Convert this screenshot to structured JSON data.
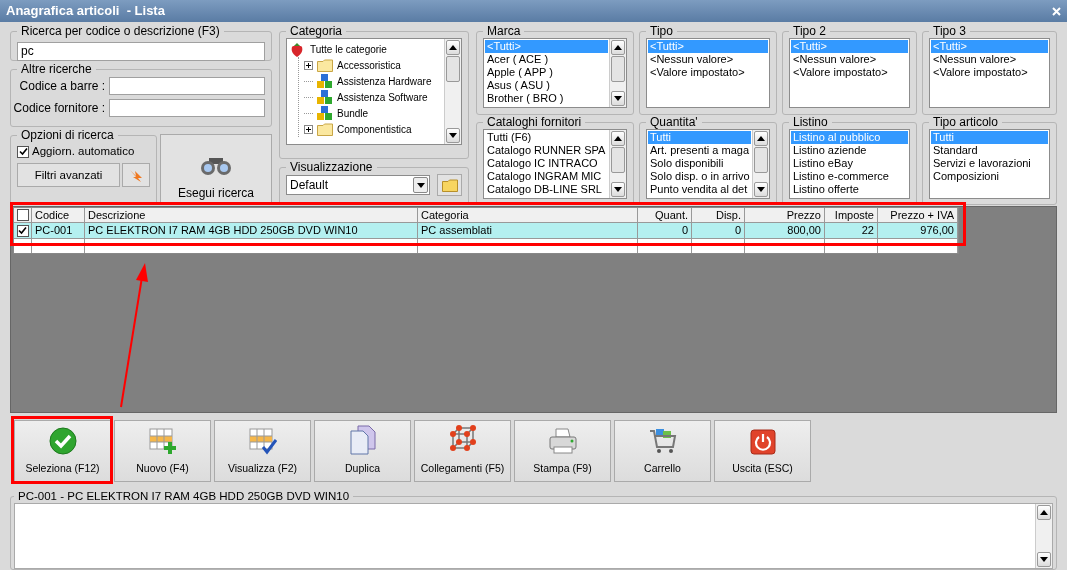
{
  "window": {
    "title": "Anagrafica articoli  - Lista"
  },
  "search": {
    "label": "Ricerca per codice o descrizione (F3)",
    "value": "pc"
  },
  "other_searches": {
    "label": "Altre ricerche",
    "fields": [
      {
        "label": "Codice a barre :"
      },
      {
        "label": "Codice fornitore :"
      }
    ]
  },
  "search_options": {
    "label": "Opzioni di ricerca",
    "auto_update": {
      "label": "Aggiorn. automatico",
      "checked": true
    },
    "advanced_filters": "Filtri avanzati"
  },
  "run_search": "Esegui ricerca",
  "category": {
    "label": "Categoria",
    "tree": [
      {
        "label": "Tutte le categorie",
        "kind": "root",
        "children": [
          {
            "label": "Accessoristica",
            "kind": "folder",
            "expandable": true
          },
          {
            "label": "Assistenza Hardware",
            "kind": "blocks",
            "expandable": false
          },
          {
            "label": "Assistenza Software",
            "kind": "blocks",
            "expandable": false
          },
          {
            "label": "Bundle",
            "kind": "blocks",
            "expandable": false
          },
          {
            "label": "Componentistica",
            "kind": "folder",
            "expandable": true
          }
        ]
      }
    ]
  },
  "view": {
    "label": "Visualizzazione",
    "value": "Default"
  },
  "filters": [
    {
      "label": "Marca",
      "scrollable": true,
      "items": [
        {
          "label": "<Tutti>",
          "selected": true
        },
        {
          "label": "Acer ( ACE )",
          "selected": false
        },
        {
          "label": "Apple ( APP )",
          "selected": false
        },
        {
          "label": "Asus ( ASU )",
          "selected": false
        },
        {
          "label": "Brother ( BRO )",
          "selected": false
        }
      ]
    },
    {
      "label": "Tipo",
      "scrollable": false,
      "items": [
        {
          "label": "<Tutti>",
          "selected": true
        },
        {
          "label": "<Nessun valore>",
          "selected": false
        },
        {
          "label": "<Valore impostato>",
          "selected": false
        }
      ]
    },
    {
      "label": "Tipo 2",
      "scrollable": false,
      "items": [
        {
          "label": "<Tutti>",
          "selected": true
        },
        {
          "label": "<Nessun valore>",
          "selected": false
        },
        {
          "label": "<Valore impostato>",
          "selected": false
        }
      ]
    },
    {
      "label": "Tipo 3",
      "scrollable": false,
      "items": [
        {
          "label": "<Tutti>",
          "selected": true
        },
        {
          "label": "<Nessun valore>",
          "selected": false
        },
        {
          "label": "<Valore impostato>",
          "selected": false
        }
      ]
    },
    {
      "label": "Cataloghi fornitori",
      "scrollable": true,
      "items": [
        {
          "label": "Tutti (F6)",
          "selected": false
        },
        {
          "label": "Catalogo RUNNER SPA",
          "selected": false
        },
        {
          "label": "Catalogo IC INTRACO",
          "selected": false
        },
        {
          "label": "Catalogo INGRAM MIC",
          "selected": false
        },
        {
          "label": "Catalogo DB-LINE SRL",
          "selected": false
        }
      ]
    },
    {
      "label": "Quantita'",
      "scrollable": true,
      "items": [
        {
          "label": "Tutti",
          "selected": true
        },
        {
          "label": "Art. presenti a maga",
          "selected": false
        },
        {
          "label": "Solo disponibili",
          "selected": false
        },
        {
          "label": "Solo disp. o in arrivo",
          "selected": false
        },
        {
          "label": "Punto vendita al det",
          "selected": false
        }
      ]
    },
    {
      "label": "Listino",
      "scrollable": false,
      "items": [
        {
          "label": "Listino al pubblico",
          "selected": true
        },
        {
          "label": "Listino aziende",
          "selected": false
        },
        {
          "label": "Listino eBay",
          "selected": false
        },
        {
          "label": "Listino e-commerce",
          "selected": false
        },
        {
          "label": "Listino offerte",
          "selected": false
        }
      ]
    },
    {
      "label": "Tipo articolo",
      "scrollable": false,
      "items": [
        {
          "label": "Tutti",
          "selected": true
        },
        {
          "label": "Standard",
          "selected": false
        },
        {
          "label": "Servizi e lavorazioni",
          "selected": false
        },
        {
          "label": "Composizioni",
          "selected": false
        }
      ]
    }
  ],
  "table": {
    "highlighted": true,
    "all_checked": false,
    "columns": [
      {
        "label": "Codice",
        "kind": "text"
      },
      {
        "label": "Descrizione",
        "kind": "text"
      },
      {
        "label": "Categoria",
        "kind": "text"
      },
      {
        "label": "Quant.",
        "kind": "number"
      },
      {
        "label": "Disp.",
        "kind": "number"
      },
      {
        "label": "Prezzo",
        "kind": "number"
      },
      {
        "label": "Imposte",
        "kind": "number"
      },
      {
        "label": "Prezzo + IVA",
        "kind": "number"
      }
    ],
    "rows": [
      {
        "selected": true,
        "checked": true,
        "cells": [
          "PC-001",
          "PC ELEKTRON I7 RAM 4GB HDD 250GB DVD WIN10",
          "PC assemblati",
          "0",
          "0",
          "800,00",
          "22",
          "976,00"
        ]
      }
    ]
  },
  "buttons": [
    {
      "label": "Seleziona (F12)",
      "kind": "select",
      "highlighted": true
    },
    {
      "label": "Nuovo (F4)",
      "kind": "new",
      "highlighted": false
    },
    {
      "label": "Visualizza (F2)",
      "kind": "view",
      "highlighted": false
    },
    {
      "label": "Duplica",
      "kind": "duplicate",
      "highlighted": false
    },
    {
      "label": "Collegamenti (F5)",
      "kind": "links",
      "highlighted": false
    },
    {
      "label": "Stampa (F9)",
      "kind": "print",
      "highlighted": false
    },
    {
      "label": "Carrello",
      "kind": "cart",
      "highlighted": false
    },
    {
      "label": "Uscita (ESC)",
      "kind": "exit",
      "highlighted": false
    }
  ],
  "details": {
    "label": "PC-001 - PC ELEKTRON I7 RAM 4GB HDD 250GB DVD WIN10"
  }
}
